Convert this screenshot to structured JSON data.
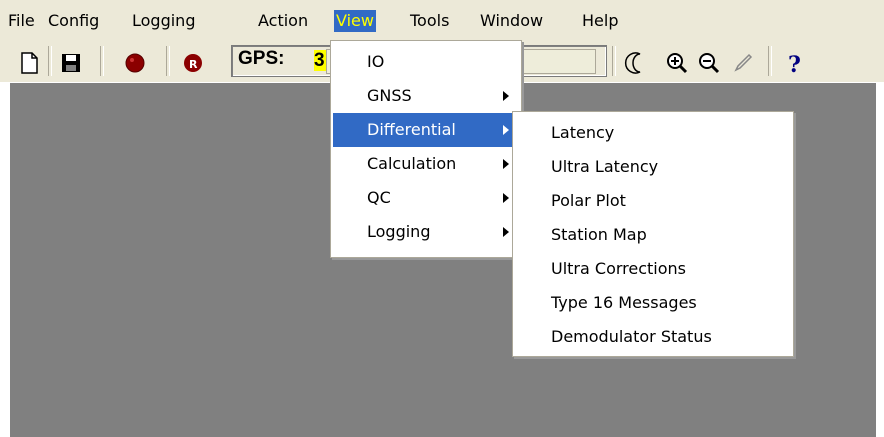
{
  "menubar": {
    "items": [
      {
        "label": "File"
      },
      {
        "label": "Config"
      },
      {
        "label": "Logging"
      },
      {
        "label": "Action"
      },
      {
        "label": "View"
      },
      {
        "label": "Tools"
      },
      {
        "label": "Window"
      },
      {
        "label": "Help"
      }
    ]
  },
  "toolbar": {
    "gps_label": "GPS:",
    "gps_value": "3",
    "icons": [
      "new-file-icon",
      "save-icon",
      "record-icon",
      "record-r-icon",
      "moon-icon",
      "zoom-in-icon",
      "zoom-out-icon",
      "pen-icon",
      "help-icon"
    ]
  },
  "view_menu": {
    "items": [
      {
        "label": "IO",
        "submenu": false
      },
      {
        "label": "GNSS",
        "submenu": true
      },
      {
        "label": "Differential",
        "submenu": true,
        "highlighted": true
      },
      {
        "label": "Calculation",
        "submenu": true
      },
      {
        "label": "QC",
        "submenu": true
      },
      {
        "label": "Logging",
        "submenu": true
      }
    ]
  },
  "differential_submenu": {
    "items": [
      {
        "label": "Latency"
      },
      {
        "label": "Ultra Latency"
      },
      {
        "label": "Polar Plot"
      },
      {
        "label": "Station Map"
      },
      {
        "label": "Ultra Corrections"
      },
      {
        "label": "Type 16 Messages"
      },
      {
        "label": "Demodulator Status"
      }
    ]
  },
  "colors": {
    "highlight": "#316AC5",
    "menu_active_text": "#FFFF00",
    "workspace": "#808080",
    "chrome": "#ECE9D8"
  }
}
